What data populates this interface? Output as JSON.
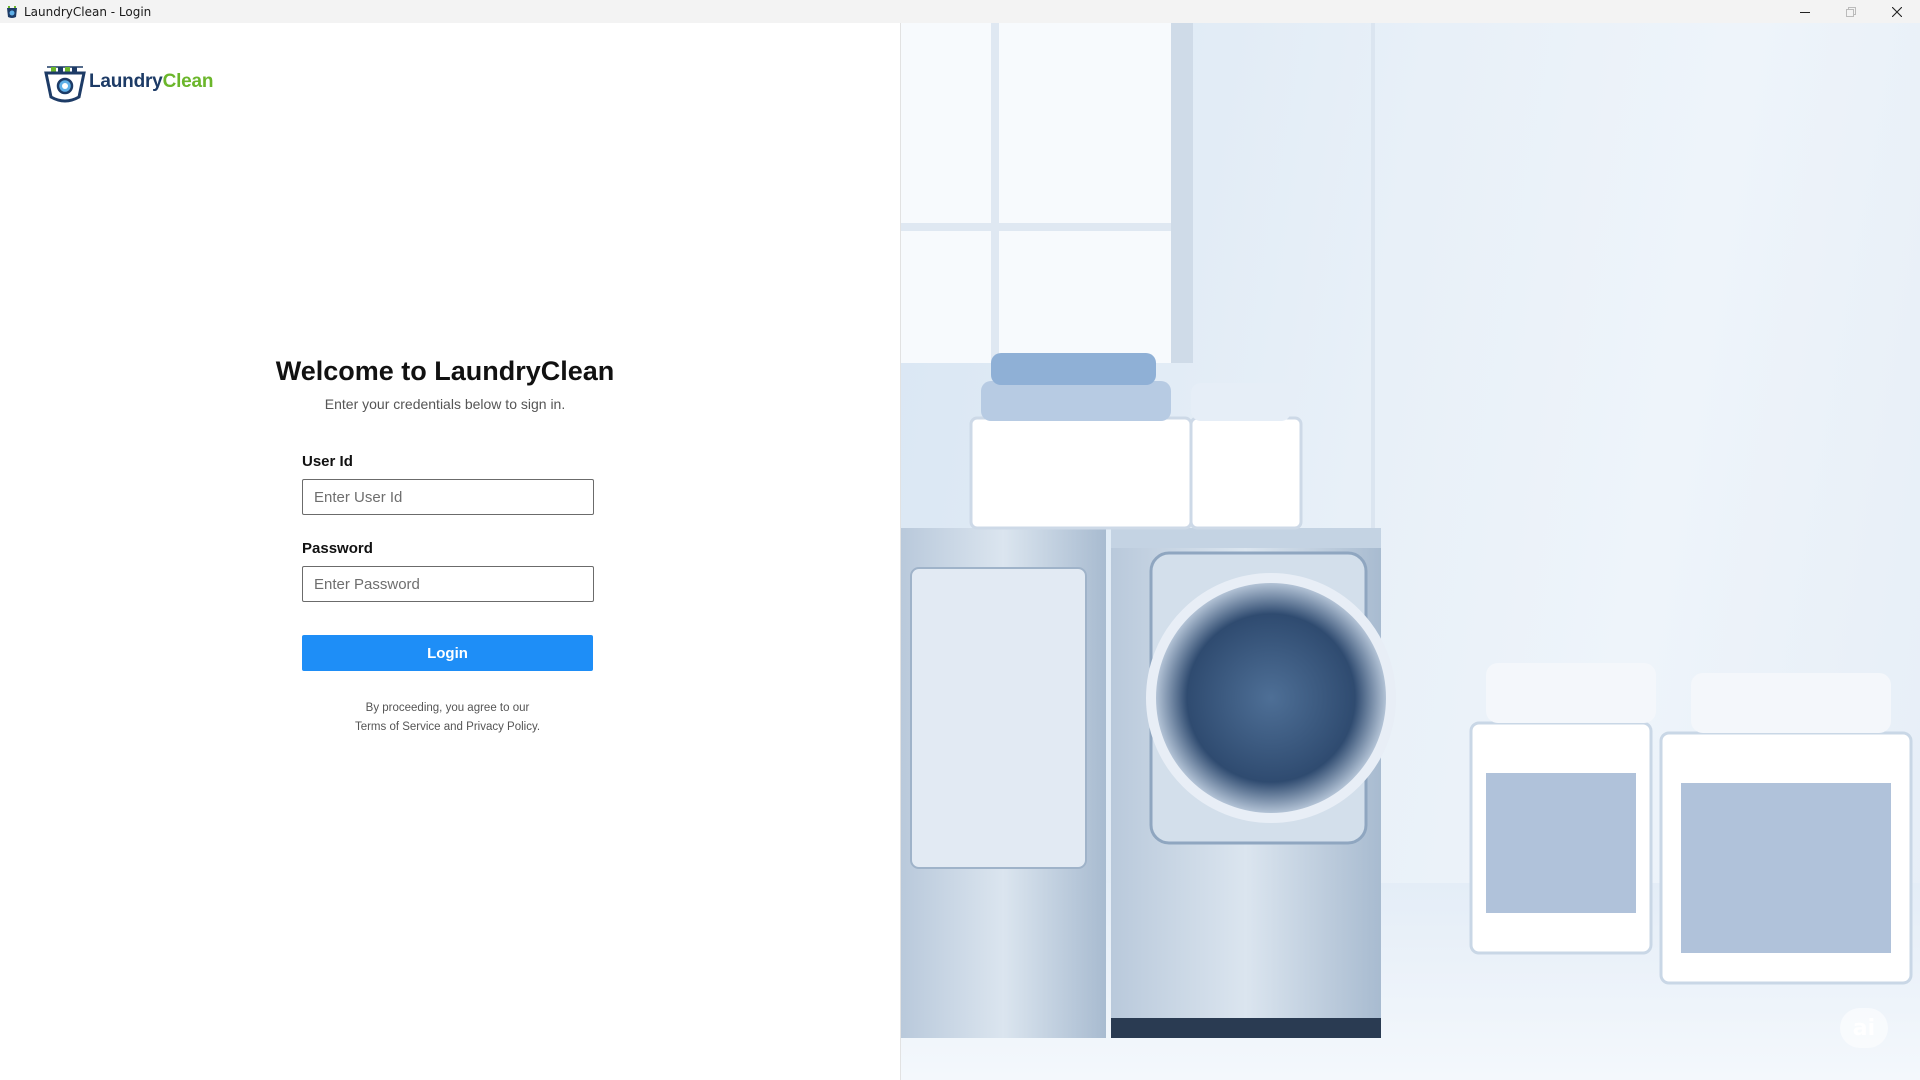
{
  "window": {
    "title": "LaundryClean - Login",
    "icons": {
      "app": "washing-basket-icon",
      "minimize": "minimize-icon",
      "maximize": "maximize-icon",
      "close": "close-icon"
    }
  },
  "brand": {
    "part1": "Laundry",
    "part2": "Clean",
    "colors": {
      "navy": "#1d3b66",
      "green": "#6bb62b"
    }
  },
  "login": {
    "heading": "Welcome to LaundryClean",
    "subtitle": "Enter your credentials below to sign in.",
    "user_id": {
      "label": "User Id",
      "placeholder": "Enter User Id",
      "value": ""
    },
    "password": {
      "label": "Password",
      "placeholder": "Enter Password",
      "value": ""
    },
    "submit_label": "Login",
    "legal_line1": "By proceeding, you agree to our",
    "legal_line2": "Terms of Service and Privacy Policy."
  },
  "hero": {
    "badge": "ai",
    "accent": "#1e8ef7"
  }
}
